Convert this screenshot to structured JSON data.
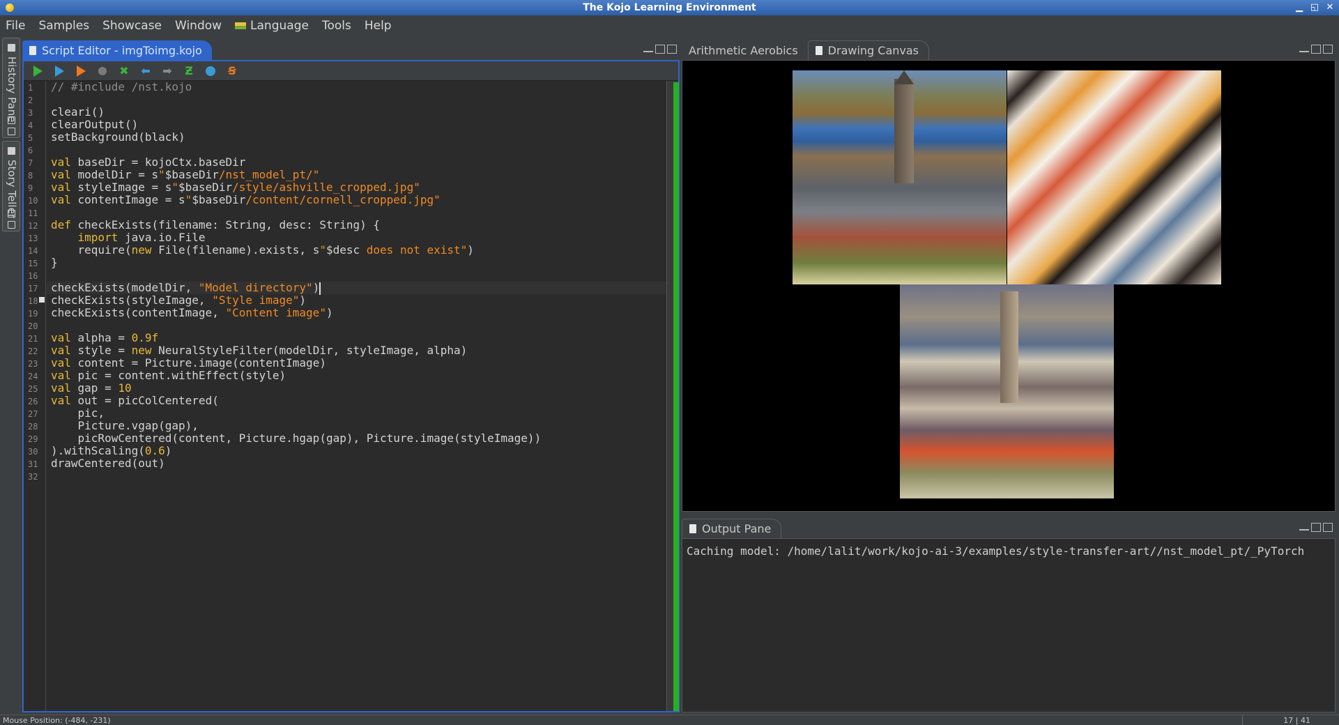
{
  "window": {
    "title": "The Kojo Learning Environment"
  },
  "menubar": {
    "items": [
      "File",
      "Samples",
      "Showcase",
      "Window",
      "Language",
      "Tools",
      "Help"
    ]
  },
  "sidebar": {
    "tabs": [
      "History Pane",
      "Story Teller"
    ]
  },
  "editor": {
    "tab_label": "Script Editor - imgToimg.kojo",
    "toolbar_icons": [
      "run-icon",
      "run-worksheet-icon",
      "trace-icon",
      "stop-icon",
      "clear-icon",
      "undo-icon",
      "redo-icon",
      "format-icon",
      "web-icon",
      "share-icon"
    ],
    "cursor": "17 | 41",
    "lines": [
      "// #include /nst.kojo",
      "",
      "cleari()",
      "clearOutput()",
      "setBackground(black)",
      "",
      "val baseDir = kojoCtx.baseDir",
      "val modelDir = s\"$baseDir/nst_model_pt/\"",
      "val styleImage = s\"$baseDir/style/ashville_cropped.jpg\"",
      "val contentImage = s\"$baseDir/content/cornell_cropped.jpg\"",
      "",
      "def checkExists(filename: String, desc: String) {",
      "    import java.io.File",
      "    require(new File(filename).exists, s\"$desc does not exist\")",
      "}",
      "",
      "checkExists(modelDir, \"Model directory\")",
      "checkExists(styleImage, \"Style image\")",
      "checkExists(contentImage, \"Content image\")",
      "",
      "val alpha = 0.9f",
      "val style = new NeuralStyleFilter(modelDir, styleImage, alpha)",
      "val content = Picture.image(contentImage)",
      "val pic = content.withEffect(style)",
      "val gap = 10",
      "val out = picColCentered(",
      "    pic,",
      "    Picture.vgap(gap),",
      "    picRowCentered(content, Picture.hgap(gap), Picture.image(styleImage))",
      ").withScaling(0.6)",
      "drawCentered(out)",
      ""
    ]
  },
  "canvas": {
    "tabs": [
      "Arithmetic Aerobics",
      "Drawing Canvas"
    ],
    "active_tab": "Drawing Canvas",
    "background": "#000000"
  },
  "output": {
    "tab_label": "Output Pane",
    "text": "Caching model: /home/lalit/work/kojo-ai-3/examples/style-transfer-art//nst_model_pt/_PyTorch"
  },
  "statusbar": {
    "mouse_position": "Mouse Position: (-484, -231)"
  },
  "colors": {
    "accent": "#2f65ca",
    "keyword": "#e6ba37",
    "string": "#f08a24",
    "run_green": "#25b024"
  }
}
